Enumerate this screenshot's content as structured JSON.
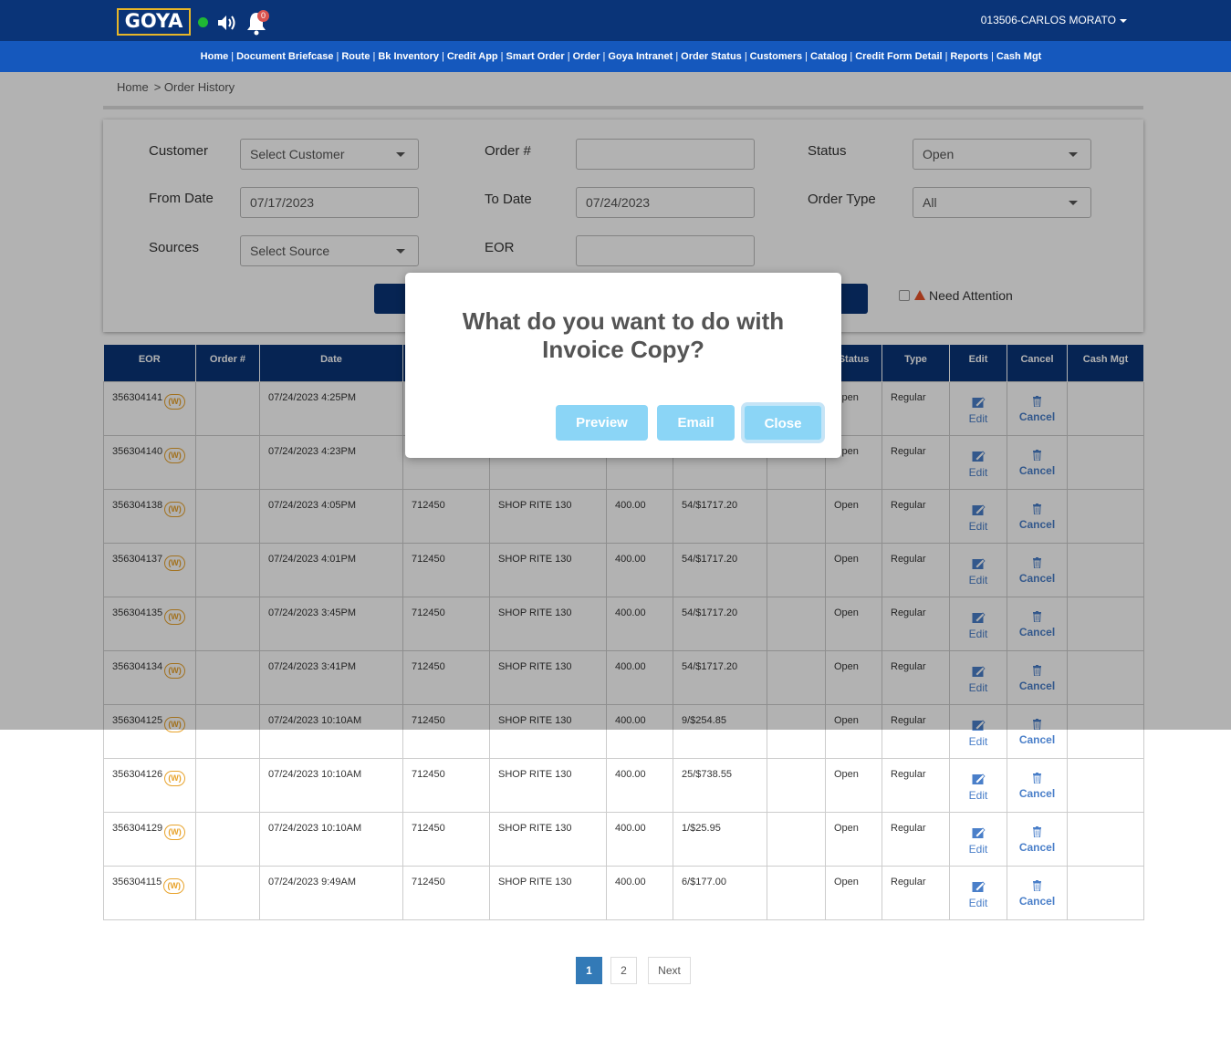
{
  "header": {
    "logo_text": "GOYA",
    "notification_count": "0",
    "user": "013506-CARLOS MORATO",
    "status_color": "#1fb834"
  },
  "nav": {
    "items": [
      "Home",
      "Document Briefcase",
      "Route",
      "Bk Inventory",
      "Credit App",
      "Smart Order",
      "Order",
      "Goya Intranet",
      "Order Status",
      "Customers",
      "Catalog",
      "Credit Form Detail",
      "Reports",
      "Cash Mgt"
    ]
  },
  "breadcrumb": {
    "home": "Home",
    "current": "> Order History"
  },
  "filters": {
    "customer_label": "Customer",
    "customer_value": "Select Customer",
    "order_label": "Order #",
    "order_value": "",
    "status_label": "Status",
    "status_value": "Open",
    "from_label": "From Date",
    "from_value": "07/17/2023",
    "to_label": "To Date",
    "to_value": "07/24/2023",
    "type_label": "Order Type",
    "type_value": "All",
    "sources_label": "Sources",
    "sources_value": "Select Source",
    "eor_label": "EOR",
    "eor_value": "",
    "need_attention_label": "Need Attention"
  },
  "table": {
    "headers": [
      "EOR",
      "Order #",
      "Date",
      "",
      "",
      "",
      "",
      "",
      "Status",
      "Type",
      "Edit",
      "Cancel",
      "Cash Mgt"
    ],
    "w_badge": "(W)",
    "edit_label": "Edit",
    "cancel_label": "Cancel",
    "rows": [
      {
        "eor": "356304141",
        "order": "",
        "date": "07/24/2023 4:25PM",
        "cust": "",
        "name": "",
        "amt": "",
        "items": "",
        "x": "",
        "status": "Open",
        "type": "Regular"
      },
      {
        "eor": "356304140",
        "order": "",
        "date": "07/24/2023 4:23PM",
        "cust": "",
        "name": "",
        "amt": "",
        "items": "",
        "x": "",
        "status": "Open",
        "type": "Regular"
      },
      {
        "eor": "356304138",
        "order": "",
        "date": "07/24/2023 4:05PM",
        "cust": "712450",
        "name": "SHOP RITE 130",
        "amt": "400.00",
        "items": "54/$1717.20",
        "x": "",
        "status": "Open",
        "type": "Regular"
      },
      {
        "eor": "356304137",
        "order": "",
        "date": "07/24/2023 4:01PM",
        "cust": "712450",
        "name": "SHOP RITE 130",
        "amt": "400.00",
        "items": "54/$1717.20",
        "x": "",
        "status": "Open",
        "type": "Regular"
      },
      {
        "eor": "356304135",
        "order": "",
        "date": "07/24/2023 3:45PM",
        "cust": "712450",
        "name": "SHOP RITE 130",
        "amt": "400.00",
        "items": "54/$1717.20",
        "x": "",
        "status": "Open",
        "type": "Regular"
      },
      {
        "eor": "356304134",
        "order": "",
        "date": "07/24/2023 3:41PM",
        "cust": "712450",
        "name": "SHOP RITE 130",
        "amt": "400.00",
        "items": "54/$1717.20",
        "x": "",
        "status": "Open",
        "type": "Regular"
      },
      {
        "eor": "356304125",
        "order": "",
        "date": "07/24/2023 10:10AM",
        "cust": "712450",
        "name": "SHOP RITE 130",
        "amt": "400.00",
        "items": "9/$254.85",
        "x": "",
        "status": "Open",
        "type": "Regular"
      },
      {
        "eor": "356304126",
        "order": "",
        "date": "07/24/2023 10:10AM",
        "cust": "712450",
        "name": "SHOP RITE 130",
        "amt": "400.00",
        "items": "25/$738.55",
        "x": "",
        "status": "Open",
        "type": "Regular"
      },
      {
        "eor": "356304129",
        "order": "",
        "date": "07/24/2023 10:10AM",
        "cust": "712450",
        "name": "SHOP RITE 130",
        "amt": "400.00",
        "items": "1/$25.95",
        "x": "",
        "status": "Open",
        "type": "Regular"
      },
      {
        "eor": "356304115",
        "order": "",
        "date": "07/24/2023 9:49AM",
        "cust": "712450",
        "name": "SHOP RITE 130",
        "amt": "400.00",
        "items": "6/$177.00",
        "x": "",
        "status": "Open",
        "type": "Regular"
      }
    ]
  },
  "pagination": {
    "pages": [
      "1",
      "2"
    ],
    "next": "Next",
    "current": "1"
  },
  "modal": {
    "title": "What do you want to do with Invoice Copy?",
    "preview": "Preview",
    "email": "Email",
    "close": "Close",
    "button_color": "#8bd5f6"
  }
}
